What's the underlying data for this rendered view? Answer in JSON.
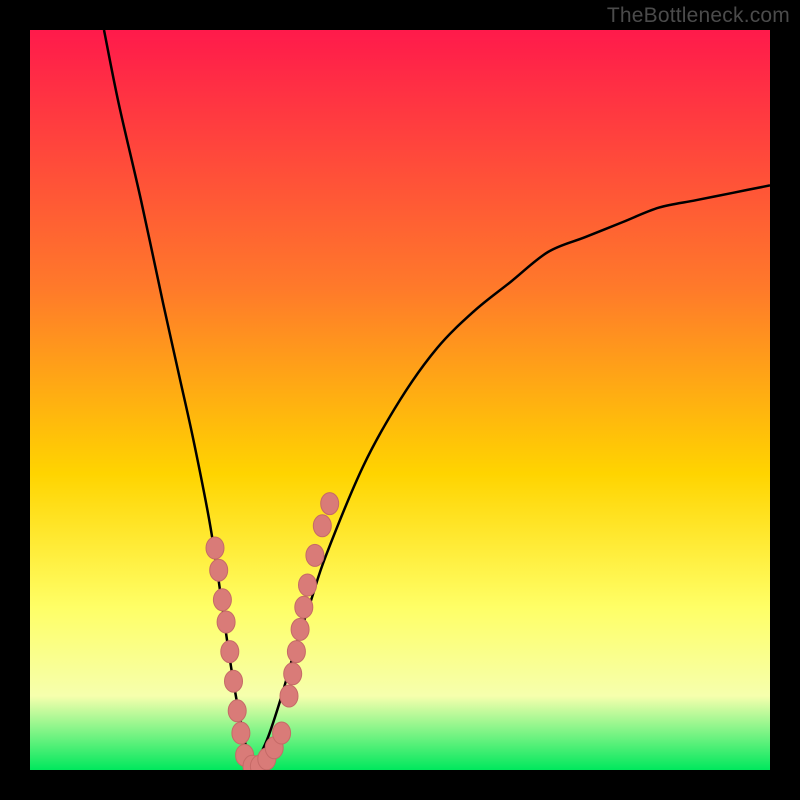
{
  "watermark": "TheBottleneck.com",
  "colors": {
    "frame": "#000000",
    "grad_top": "#ff1a4b",
    "grad_mid1": "#ff7a2a",
    "grad_mid2": "#ffd400",
    "grad_mid3": "#ffff66",
    "grad_mid4": "#f6ffad",
    "grad_bottom": "#00e85d",
    "curve": "#000000",
    "dot_fill": "#d97b78",
    "dot_stroke": "#c56a67"
  },
  "chart_data": {
    "type": "line",
    "title": "",
    "xlabel": "",
    "ylabel": "",
    "xlim": [
      0,
      100
    ],
    "ylim": [
      0,
      100
    ],
    "series": [
      {
        "name": "left-branch",
        "x": [
          10,
          12,
          15,
          18,
          20,
          22,
          24,
          25,
          26,
          27,
          28,
          29,
          30
        ],
        "y": [
          100,
          90,
          77,
          63,
          54,
          45,
          35,
          29,
          22,
          15,
          9,
          4,
          0
        ]
      },
      {
        "name": "right-branch",
        "x": [
          30,
          32,
          34,
          36,
          38,
          40,
          45,
          50,
          55,
          60,
          65,
          70,
          75,
          80,
          85,
          90,
          95,
          100
        ],
        "y": [
          0,
          4,
          10,
          17,
          23,
          29,
          41,
          50,
          57,
          62,
          66,
          70,
          72,
          74,
          76,
          77,
          78,
          79
        ]
      }
    ],
    "dot_clusters": [
      {
        "name": "left-dots",
        "points": [
          [
            25.0,
            30.0
          ],
          [
            25.5,
            27.0
          ],
          [
            26.0,
            23.0
          ],
          [
            26.5,
            20.0
          ],
          [
            27.0,
            16.0
          ],
          [
            27.5,
            12.0
          ],
          [
            28.0,
            8.0
          ],
          [
            28.5,
            5.0
          ]
        ]
      },
      {
        "name": "bottom-dots",
        "points": [
          [
            29.0,
            2.0
          ],
          [
            30.0,
            0.5
          ],
          [
            31.0,
            0.5
          ],
          [
            32.0,
            1.5
          ],
          [
            33.0,
            3.0
          ],
          [
            34.0,
            5.0
          ]
        ]
      },
      {
        "name": "right-dots",
        "points": [
          [
            35.0,
            10.0
          ],
          [
            35.5,
            13.0
          ],
          [
            36.0,
            16.0
          ],
          [
            36.5,
            19.0
          ],
          [
            37.0,
            22.0
          ],
          [
            37.5,
            25.0
          ],
          [
            38.5,
            29.0
          ],
          [
            39.5,
            33.0
          ],
          [
            40.5,
            36.0
          ]
        ]
      }
    ]
  }
}
